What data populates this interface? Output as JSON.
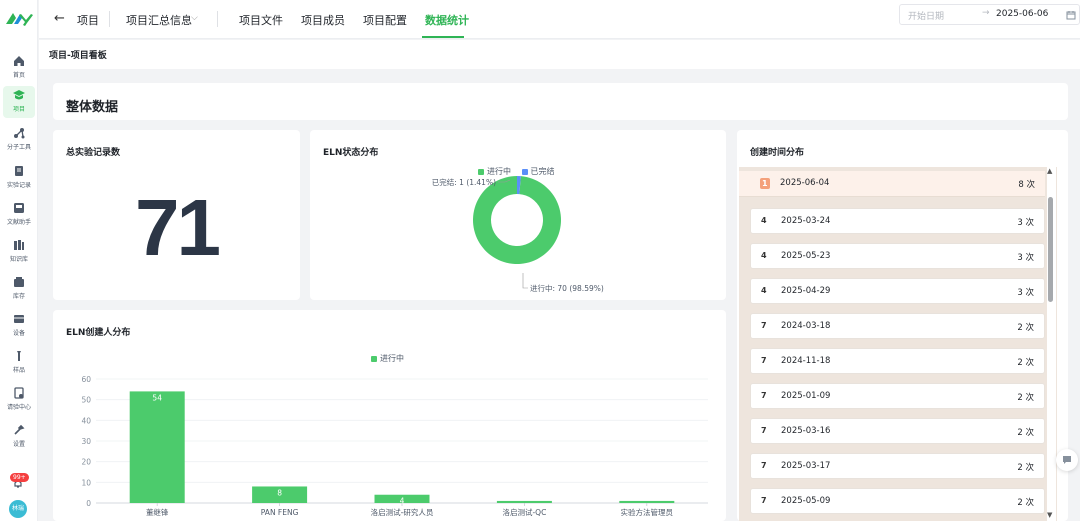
{
  "app": {
    "logo_text": "KY"
  },
  "sidebar": {
    "items": [
      {
        "label": "首页",
        "icon": "home-icon"
      },
      {
        "label": "项目",
        "icon": "project-icon",
        "active": true
      },
      {
        "label": "分子工具",
        "icon": "molecule-icon"
      },
      {
        "label": "实验记录",
        "icon": "notebook-icon"
      },
      {
        "label": "文献助手",
        "icon": "literature-icon"
      },
      {
        "label": "知识库",
        "icon": "knowledge-icon"
      },
      {
        "label": "库存",
        "icon": "inventory-icon"
      },
      {
        "label": "设备",
        "icon": "device-icon"
      },
      {
        "label": "样品",
        "icon": "sample-icon"
      },
      {
        "label": "请验中心",
        "icon": "request-icon"
      },
      {
        "label": "设置",
        "icon": "settings-icon"
      }
    ],
    "notification_badge": "99+",
    "avatar_text": "林瑞"
  },
  "topbar": {
    "back_label": "项目",
    "project_selector": "项目汇总信息",
    "tabs": [
      {
        "label": "项目文件"
      },
      {
        "label": "项目成员"
      },
      {
        "label": "项目配置"
      },
      {
        "label": "数据统计",
        "active": true
      }
    ]
  },
  "subheader": {
    "breadcrumb": "项目-项目看板",
    "date_start_placeholder": "开始日期",
    "date_arrow": "→",
    "date_end": "2025-06-06"
  },
  "overview": {
    "title": "整体数据"
  },
  "total_records": {
    "title": "总实验记录数",
    "value": "71"
  },
  "eln_status": {
    "title": "ELN状态分布",
    "legend": [
      "进行中",
      "已完结"
    ],
    "label_done": "已完结: 1 (1.41%)",
    "label_progress": "进行中: 70 (98.59%)"
  },
  "eln_creator": {
    "title": "ELN创建人分布",
    "legend": "进行中",
    "y_ticks": [
      "60",
      "50",
      "40",
      "30",
      "20",
      "10",
      "0"
    ]
  },
  "time_dist": {
    "title": "创建时间分布",
    "rows": [
      {
        "rank": "1",
        "date": "2025-06-04",
        "count": "8 次"
      },
      {
        "rank": "4",
        "date": "2025-03-24",
        "count": "3 次"
      },
      {
        "rank": "4",
        "date": "2025-05-23",
        "count": "3 次"
      },
      {
        "rank": "4",
        "date": "2025-04-29",
        "count": "3 次"
      },
      {
        "rank": "7",
        "date": "2024-03-18",
        "count": "2 次"
      },
      {
        "rank": "7",
        "date": "2024-11-18",
        "count": "2 次"
      },
      {
        "rank": "7",
        "date": "2025-01-09",
        "count": "2 次"
      },
      {
        "rank": "7",
        "date": "2025-03-16",
        "count": "2 次"
      },
      {
        "rank": "7",
        "date": "2025-03-17",
        "count": "2 次"
      },
      {
        "rank": "7",
        "date": "2025-05-09",
        "count": "2 次"
      }
    ]
  },
  "colors": {
    "accent": "#2fb455",
    "bar": "#4ccb6c",
    "done": "#5b8ff9"
  },
  "chart_data": [
    {
      "type": "pie",
      "title": "ELN状态分布",
      "categories": [
        "进行中",
        "已完结"
      ],
      "values": [
        70,
        1
      ],
      "percent": [
        98.59,
        1.41
      ],
      "legend_position": "top"
    },
    {
      "type": "bar",
      "title": "ELN创建人分布",
      "categories": [
        "董继锋",
        "PAN FENG",
        "洛启测试-研究人员",
        "洛启测试-QC",
        "实验方法管理员"
      ],
      "series": [
        {
          "name": "进行中",
          "values": [
            54,
            8,
            4,
            1,
            1
          ]
        }
      ],
      "ylim": [
        0,
        60
      ],
      "grid": true,
      "legend_position": "top"
    }
  ]
}
